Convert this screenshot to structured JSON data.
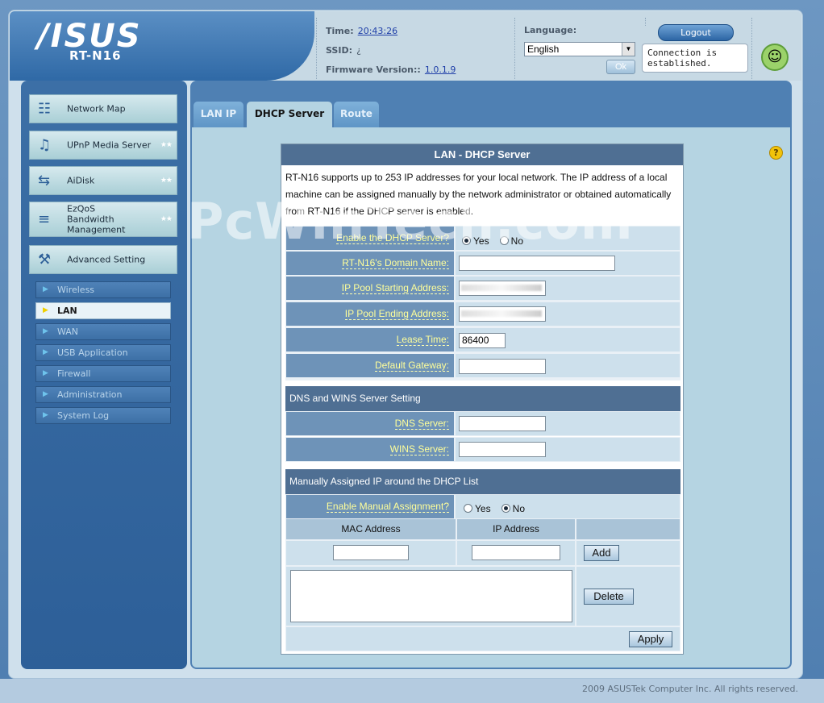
{
  "header": {
    "brand": "/ISUS",
    "model": "RT-N16",
    "time_label": "Time:",
    "time_value": "20:43:26",
    "ssid_label": "SSID:",
    "ssid_value": "¿",
    "firmware_label": "Firmware Version::",
    "firmware_value": "1.0.1.9",
    "language_label": "Language:",
    "language_value": "English",
    "ok_label": "Ok",
    "logout_label": "Logout",
    "connection_status": "Connection is established."
  },
  "menu": {
    "main_items": [
      {
        "label": "Network Map",
        "icon": "network-map-icon"
      },
      {
        "label": "UPnP Media Server",
        "icon": "media-server-icon"
      },
      {
        "label": "AiDisk",
        "icon": "aidisk-icon"
      },
      {
        "label": "EzQoS Bandwidth Management",
        "icon": "ezqos-icon"
      },
      {
        "label": "Advanced Setting",
        "icon": "advanced-setting-icon"
      }
    ],
    "sub_items": [
      {
        "label": "Wireless",
        "active": false
      },
      {
        "label": "LAN",
        "active": true
      },
      {
        "label": "WAN",
        "active": false
      },
      {
        "label": "USB Application",
        "active": false
      },
      {
        "label": "Firewall",
        "active": false
      },
      {
        "label": "Administration",
        "active": false
      },
      {
        "label": "System Log",
        "active": false
      }
    ]
  },
  "tabs": [
    {
      "label": "LAN IP",
      "active": false
    },
    {
      "label": "DHCP Server",
      "active": true
    },
    {
      "label": "Route",
      "active": false
    }
  ],
  "watermark": "PcWinTech.com",
  "panel": {
    "title": "LAN - DHCP Server",
    "description": "RT-N16 supports up to 253 IP addresses for your local network. The IP address of a local machine can be assigned manually by the network administrator or obtained automatically from RT-N16 if the DHCP server is enabled.",
    "enable_dhcp_label": "Enable the DHCP Server?",
    "yes_label": "Yes",
    "no_label": "No",
    "dhcp_enabled": "Yes",
    "domain_name_label": "RT-N16's Domain Name:",
    "domain_name_value": "",
    "pool_start_label": "IP Pool Starting Address:",
    "pool_end_label": "IP Pool Ending Address:",
    "lease_time_label": "Lease Time:",
    "lease_time_value": "86400",
    "default_gateway_label": "Default Gateway:",
    "default_gateway_value": "",
    "dns_wins_section": "DNS and WINS Server Setting",
    "dns_server_label": "DNS Server:",
    "dns_server_value": "",
    "wins_server_label": "WINS Server:",
    "wins_server_value": "",
    "manual_section": "Manually Assigned IP around the DHCP List",
    "enable_manual_label": "Enable Manual Assignment?",
    "manual_enabled": "No",
    "mac_header": "MAC Address",
    "ip_header": "IP Address",
    "add_label": "Add",
    "delete_label": "Delete",
    "apply_label": "Apply"
  },
  "footer": "2009 ASUSTek Computer Inc. All rights reserved."
}
